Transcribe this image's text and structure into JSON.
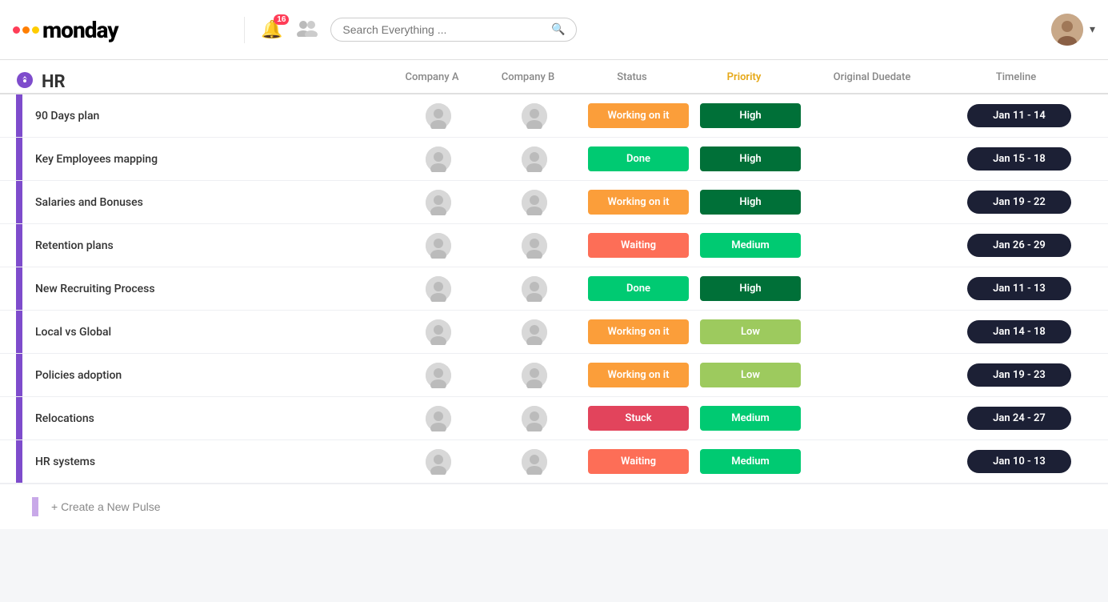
{
  "header": {
    "logo_text": "monday",
    "notifications_count": "16",
    "search_placeholder": "Search Everything ...",
    "search_label": "Search Everything"
  },
  "board": {
    "title": "HR",
    "columns": {
      "company_a": "Company A",
      "company_b": "Company B",
      "status": "Status",
      "priority": "Priority",
      "duedate": "Original Duedate",
      "timeline": "Timeline"
    },
    "rows": [
      {
        "name": "90 Days plan",
        "status": "Working on it",
        "status_class": "status-working",
        "priority": "High",
        "priority_class": "priority-high",
        "timeline": "Jan 11 - 14"
      },
      {
        "name": "Key Employees mapping",
        "status": "Done",
        "status_class": "status-done",
        "priority": "High",
        "priority_class": "priority-high",
        "timeline": "Jan 15 - 18"
      },
      {
        "name": "Salaries and Bonuses",
        "status": "Working on it",
        "status_class": "status-working",
        "priority": "High",
        "priority_class": "priority-high",
        "timeline": "Jan 19 - 22"
      },
      {
        "name": "Retention plans",
        "status": "Waiting",
        "status_class": "status-waiting",
        "priority": "Medium",
        "priority_class": "priority-medium",
        "timeline": "Jan 26 - 29"
      },
      {
        "name": "New Recruiting Process",
        "status": "Done",
        "status_class": "status-done",
        "priority": "High",
        "priority_class": "priority-high",
        "timeline": "Jan 11 - 13"
      },
      {
        "name": "Local vs Global",
        "status": "Working on it",
        "status_class": "status-working",
        "priority": "Low",
        "priority_class": "priority-low",
        "timeline": "Jan 14 - 18"
      },
      {
        "name": "Policies adoption",
        "status": "Working on it",
        "status_class": "status-working",
        "priority": "Low",
        "priority_class": "priority-low",
        "timeline": "Jan 19 - 23"
      },
      {
        "name": "Relocations",
        "status": "Stuck",
        "status_class": "status-stuck",
        "priority": "Medium",
        "priority_class": "priority-medium",
        "timeline": "Jan 24 - 27"
      },
      {
        "name": "HR systems",
        "status": "Waiting",
        "status_class": "status-waiting",
        "priority": "Medium",
        "priority_class": "priority-medium",
        "timeline": "Jan 10 - 13"
      }
    ],
    "create_pulse_label": "+ Create a New Pulse"
  }
}
